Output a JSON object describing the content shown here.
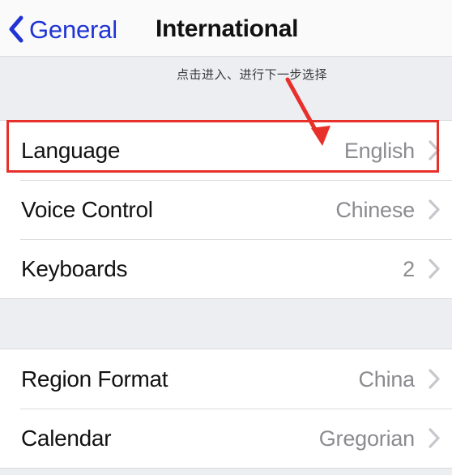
{
  "navbar": {
    "back_label": "General",
    "back_icon": "chevron-left-icon",
    "title": "International",
    "back_color": "#2034D4"
  },
  "annotation": {
    "text": "点击进入、进行下一步选择",
    "arrow_color": "#E8302A",
    "arrow_from": "355,103",
    "arrow_to": "398,180"
  },
  "highlight": {
    "color": "#E8302A",
    "target_row": "Language"
  },
  "groups": [
    {
      "id": "group-primary",
      "rows": [
        {
          "label": "Language",
          "value": "English",
          "chevron": "chevron-right-icon"
        },
        {
          "label": "Voice Control",
          "value": "Chinese",
          "chevron": "chevron-right-icon"
        },
        {
          "label": "Keyboards",
          "value": "2",
          "chevron": "chevron-right-icon"
        }
      ]
    },
    {
      "id": "group-secondary",
      "rows": [
        {
          "label": "Region Format",
          "value": "China",
          "chevron": "chevron-right-icon"
        },
        {
          "label": "Calendar",
          "value": "Gregorian",
          "chevron": "chevron-right-icon"
        }
      ]
    }
  ],
  "colors": {
    "page_background": "#EDEEF2",
    "row_background": "#FFFFFF",
    "label_text": "#121212",
    "value_text": "#8B8B90",
    "chevron": "#C7C7CC",
    "separator": "#DDDDE0",
    "accent_red": "#E8302A",
    "accent_blue": "#2034D4"
  }
}
